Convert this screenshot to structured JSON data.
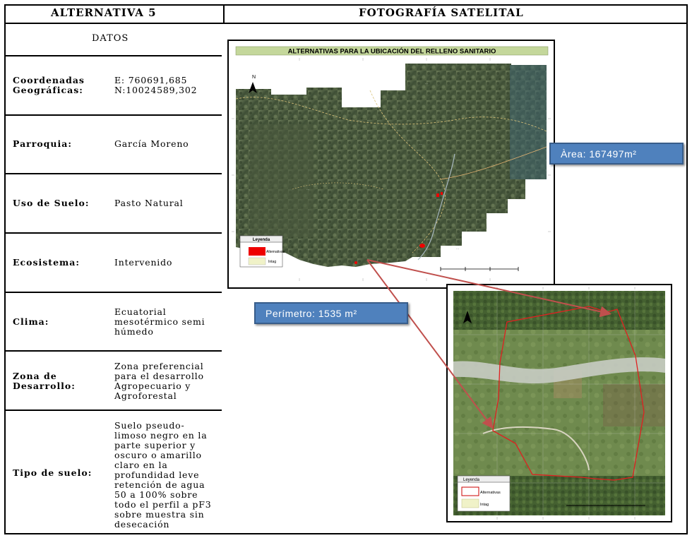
{
  "header": {
    "left_title": "ALTERNATIVA 5",
    "right_title": "FOTOGRAFÍA SATELITAL"
  },
  "datos_label": "DATOS",
  "rows": {
    "coordenadas": {
      "label_1": "Coordenadas",
      "label_2": "Geográficas:",
      "value_1": "E: 760691,685",
      "value_2": "N:10024589,302"
    },
    "parroquia": {
      "label": "Parroquia:",
      "value": "García Moreno"
    },
    "uso_suelo": {
      "label": "Uso de Suelo:",
      "value": "Pasto Natural"
    },
    "ecosistema": {
      "label": "Ecosistema:",
      "value": "Intervenido"
    },
    "clima": {
      "label": "Clima:",
      "v1": "Ecuatorial",
      "v2": "mesotérmico semi",
      "v3": "húmedo"
    },
    "zona": {
      "label_1": "Zona de",
      "label_2": "Desarrollo:",
      "v1": "Zona preferencial",
      "v2": "para el desarrollo",
      "v3": "Agropecuario y",
      "v4": "Agroforestal"
    },
    "tipo": {
      "label": "Tipo de suelo:",
      "lines": [
        "Suelo pseudo-",
        "limoso negro en la",
        "parte superior y",
        "oscuro o amarillo",
        "claro en la",
        "profundidad leve",
        "retención de agua",
        "50 a 100% sobre",
        "todo el perfil a pF3",
        "sobre muestra sin",
        "desecación"
      ]
    }
  },
  "map1": {
    "title": "ALTERNATIVAS PARA LA UBICACIÓN DEL RELLENO SANITARIO",
    "north": "N",
    "legend_title": "Leyenda",
    "legend_alt": "Alternativas",
    "legend_intag": "Intag"
  },
  "map2": {
    "legend_title": "Leyenda",
    "legend_alt": "Alternativas",
    "legend_intag": "Intag"
  },
  "callouts": {
    "area": "Àrea: 167497m²",
    "perimetro": "Perímetro: 1535 m²"
  },
  "colors": {
    "callout_fill": "#4f81bd",
    "arrow": "#c0504d",
    "title_bar": "#c4d79b"
  }
}
